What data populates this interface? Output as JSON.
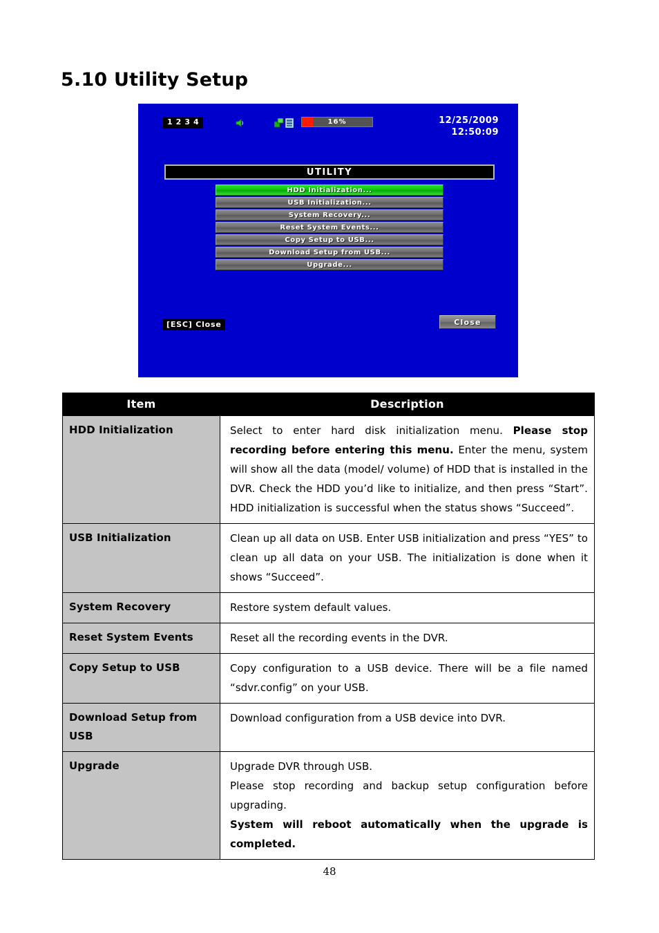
{
  "heading": "5.10 Utility Setup",
  "dvr": {
    "channels": [
      "1",
      "2",
      "3",
      "4"
    ],
    "icons": {
      "audio": "speaker-icon",
      "network": "network-icon",
      "recording": "film-icon"
    },
    "progress": {
      "label": "16%",
      "percent": 16,
      "fill_color": "#ff1a00",
      "track_color": "#545454"
    },
    "date": "12/25/2009",
    "time": "12:50:09",
    "title": "UTILITY",
    "background_color": "#0000cc",
    "selected_color": "#0ec40e",
    "menu": [
      {
        "label": "HDD Initialization...",
        "selected": true
      },
      {
        "label": "USB Initialization...",
        "selected": false
      },
      {
        "label": "System Recovery...",
        "selected": false
      },
      {
        "label": "Reset System Events...",
        "selected": false
      },
      {
        "label": "Copy Setup to USB...",
        "selected": false
      },
      {
        "label": "Download Setup from USB...",
        "selected": false
      },
      {
        "label": "Upgrade...",
        "selected": false
      }
    ],
    "esc_hint": "[ESC] Close",
    "close_button": "Close"
  },
  "table": {
    "headers": {
      "item": "Item",
      "description": "Description"
    },
    "rows": [
      {
        "item": "HDD Initialization",
        "desc_parts": [
          {
            "text": "Select to enter hard disk initialization menu. ",
            "bold": false
          },
          {
            "text": "Please stop recording before entering this menu.",
            "bold": true
          },
          {
            "text": " Enter the menu, system will show all the data (model/ volume) of HDD that is installed in the DVR. Check the HDD you’d like to initialize, and then press “Start”. HDD initialization is successful when the status shows “Succeed”.",
            "bold": false
          }
        ]
      },
      {
        "item": "USB Initialization",
        "desc_parts": [
          {
            "text": "Clean up all data on USB. Enter USB initialization and press “YES” to clean up all data on your USB. The initialization is done when it shows “Succeed”.",
            "bold": false
          }
        ]
      },
      {
        "item": "System Recovery",
        "desc_parts": [
          {
            "text": "Restore system default values.",
            "bold": false
          }
        ]
      },
      {
        "item": "Reset System Events",
        "desc_parts": [
          {
            "text": "Reset all the recording events in the DVR.",
            "bold": false
          }
        ]
      },
      {
        "item": "Copy Setup to USB",
        "desc_parts": [
          {
            "text": "Copy configuration to a USB device. There will be a file named “sdvr.config” on your USB.",
            "bold": false
          }
        ]
      },
      {
        "item": "Download Setup from USB",
        "desc_parts": [
          {
            "text": "Download configuration from a USB device into DVR.",
            "bold": false
          }
        ]
      },
      {
        "item": "Upgrade",
        "desc_parts": [
          {
            "text": "Upgrade DVR through USB.\nPlease stop recording and backup setup configuration before upgrading.\n",
            "bold": false
          },
          {
            "text": "System will reboot automatically when the upgrade is completed.",
            "bold": true
          }
        ]
      }
    ]
  },
  "page_number": "48"
}
